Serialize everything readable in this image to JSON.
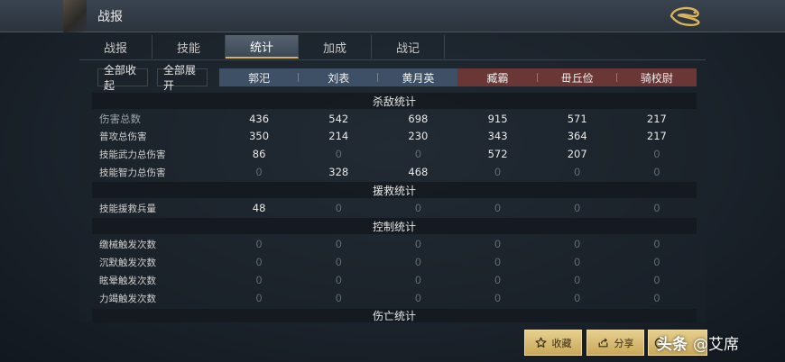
{
  "window": {
    "title": "战报"
  },
  "tabs": [
    {
      "label": "战报"
    },
    {
      "label": "技能"
    },
    {
      "label": "统计"
    },
    {
      "label": "加成"
    },
    {
      "label": "战记"
    }
  ],
  "active_tab": "统计",
  "controls": {
    "collapse_all": "全部收起",
    "expand_all": "全部展开"
  },
  "team_colors": {
    "blue": "#3e5066",
    "red": "#6a3636"
  },
  "generals": [
    {
      "name": "郭汜",
      "team": "blue"
    },
    {
      "name": "刘表",
      "team": "blue"
    },
    {
      "name": "黄月英",
      "team": "blue"
    },
    {
      "name": "臧霸",
      "team": "red"
    },
    {
      "name": "毌丘俭",
      "team": "red"
    },
    {
      "name": "骑校尉",
      "team": "red"
    }
  ],
  "sections": {
    "kill": {
      "title": "杀敌统计",
      "rows": [
        {
          "label": "伤害总数",
          "values": [
            "436",
            "542",
            "698",
            "915",
            "571",
            "217"
          ]
        },
        {
          "label": "普攻总伤害",
          "values": [
            "350",
            "214",
            "230",
            "343",
            "364",
            "217"
          ]
        },
        {
          "label": "技能武力总伤害",
          "values": [
            "86",
            "0",
            "0",
            "572",
            "207",
            "0"
          ]
        },
        {
          "label": "技能智力总伤害",
          "values": [
            "0",
            "328",
            "468",
            "0",
            "0",
            "0"
          ]
        }
      ]
    },
    "rescue": {
      "title": "援救统计",
      "rows": [
        {
          "label": "技能援救兵量",
          "values": [
            "48",
            "0",
            "0",
            "0",
            "0",
            "0"
          ]
        }
      ]
    },
    "control": {
      "title": "控制统计",
      "rows": [
        {
          "label": "缴械触发次数",
          "values": [
            "0",
            "0",
            "0",
            "0",
            "0",
            "0"
          ]
        },
        {
          "label": "沉默触发次数",
          "values": [
            "0",
            "0",
            "0",
            "0",
            "0",
            "0"
          ]
        },
        {
          "label": "眩晕触发次数",
          "values": [
            "0",
            "0",
            "0",
            "0",
            "0",
            "0"
          ]
        },
        {
          "label": "力竭触发次数",
          "values": [
            "0",
            "0",
            "0",
            "0",
            "0",
            "0"
          ]
        }
      ]
    },
    "casualty": {
      "title": "伤亡统计"
    }
  },
  "actions": {
    "favorite": "收藏",
    "share": "分享"
  },
  "icons": {
    "close": "dragon-close-icon",
    "favorite": "star-icon",
    "share": "share-icon",
    "play": "play-icon"
  },
  "watermark": {
    "brand": "头条",
    "handle": "@艾席"
  }
}
